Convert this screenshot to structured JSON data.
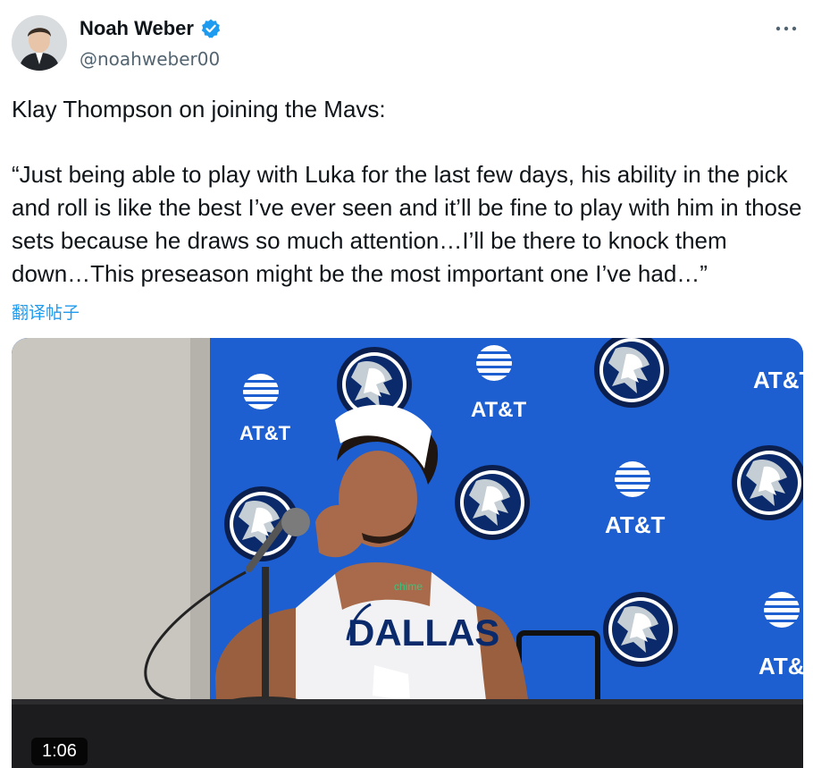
{
  "author": {
    "display_name": "Noah Weber",
    "handle": "@noahweber00",
    "verified": true
  },
  "tweet": {
    "intro": "Klay Thompson on joining the Mavs:",
    "quote": "“Just being able to play with Luka for the last few days, his ability in the pick and roll is like the best I’ve ever seen and it’ll be fine to play with him in those sets because he draws so much attention…I’ll be there to knock them down…This preseason might be the most important one I’ve had…”",
    "translate_label": "翻译帖子"
  },
  "media": {
    "duration": "1:06",
    "backdrop_text": "AT&T",
    "jersey_text": "DALLAS",
    "sponsor_text": "chime"
  },
  "colors": {
    "accent": "#1d9bf0",
    "backdrop_blue": "#1d5fd1"
  },
  "icons": {
    "more": "more-icon",
    "verified": "verified-badge-icon"
  }
}
